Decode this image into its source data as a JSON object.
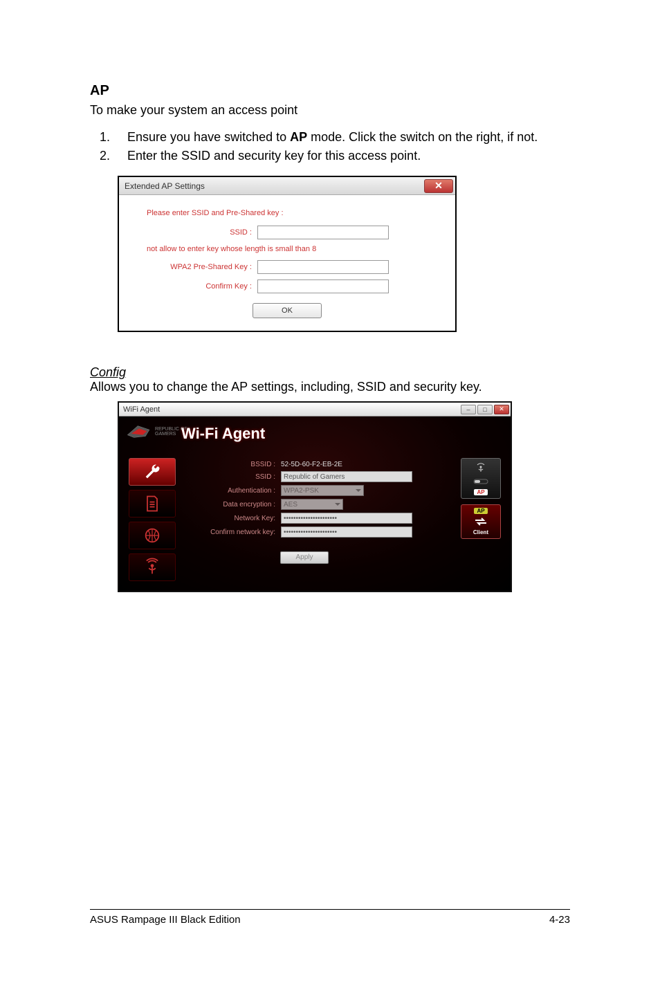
{
  "section": {
    "heading": "AP",
    "subheading": "To make your system an access point",
    "steps": [
      {
        "num": "1.",
        "text_a": "Ensure you have switched to ",
        "bold": "AP",
        "text_b": " mode. Click the switch on the right, if not."
      },
      {
        "num": "2.",
        "text_a": "Enter the SSID and security key for this access point.",
        "bold": "",
        "text_b": ""
      }
    ]
  },
  "dialog1": {
    "title": "Extended AP Settings",
    "close_glyph": "✕",
    "instruction": "Please enter SSID and Pre-Shared key :",
    "ssid_label": "SSID :",
    "ssid_value": "",
    "note": "not allow to enter key whose length is small than 8",
    "psk_label": "WPA2 Pre-Shared Key :",
    "psk_value": "",
    "confirm_label": "Confirm Key :",
    "confirm_value": "",
    "ok_label": "OK"
  },
  "config": {
    "heading": "Config",
    "desc": "Allows you to change the AP settings, including, SSID and security key."
  },
  "dialog2": {
    "win_title": "WiFi Agent",
    "app_title": "Wi-Fi Agent",
    "rog_text": "REPUBLIC OF\nGAMERS",
    "minimize_glyph": "–",
    "maximize_glyph": "□",
    "close_glyph": "✕",
    "fields": {
      "bssid_label": "BSSID :",
      "bssid_value": "52-5D-60-F2-EB-2E",
      "ssid_label": "SSID :",
      "ssid_value": "Republic of Gamers",
      "auth_label": "Authentication :",
      "auth_value": "WPA2-PSK",
      "enc_label": "Data encryption :",
      "enc_value": "AES",
      "netkey_label": "Network Key:",
      "netkey_value": "••••••••••••••••••••••",
      "confkey_label": "Confirm network key:",
      "confkey_value": "••••••••••••••••••••••"
    },
    "apply_label": "Apply",
    "modes": {
      "ap_tag": "AP",
      "ap_label_top": "",
      "client_tag": "AP",
      "client_label": "Client"
    }
  },
  "footer": {
    "left": "ASUS Rampage III Black Edition",
    "right": "4-23"
  }
}
